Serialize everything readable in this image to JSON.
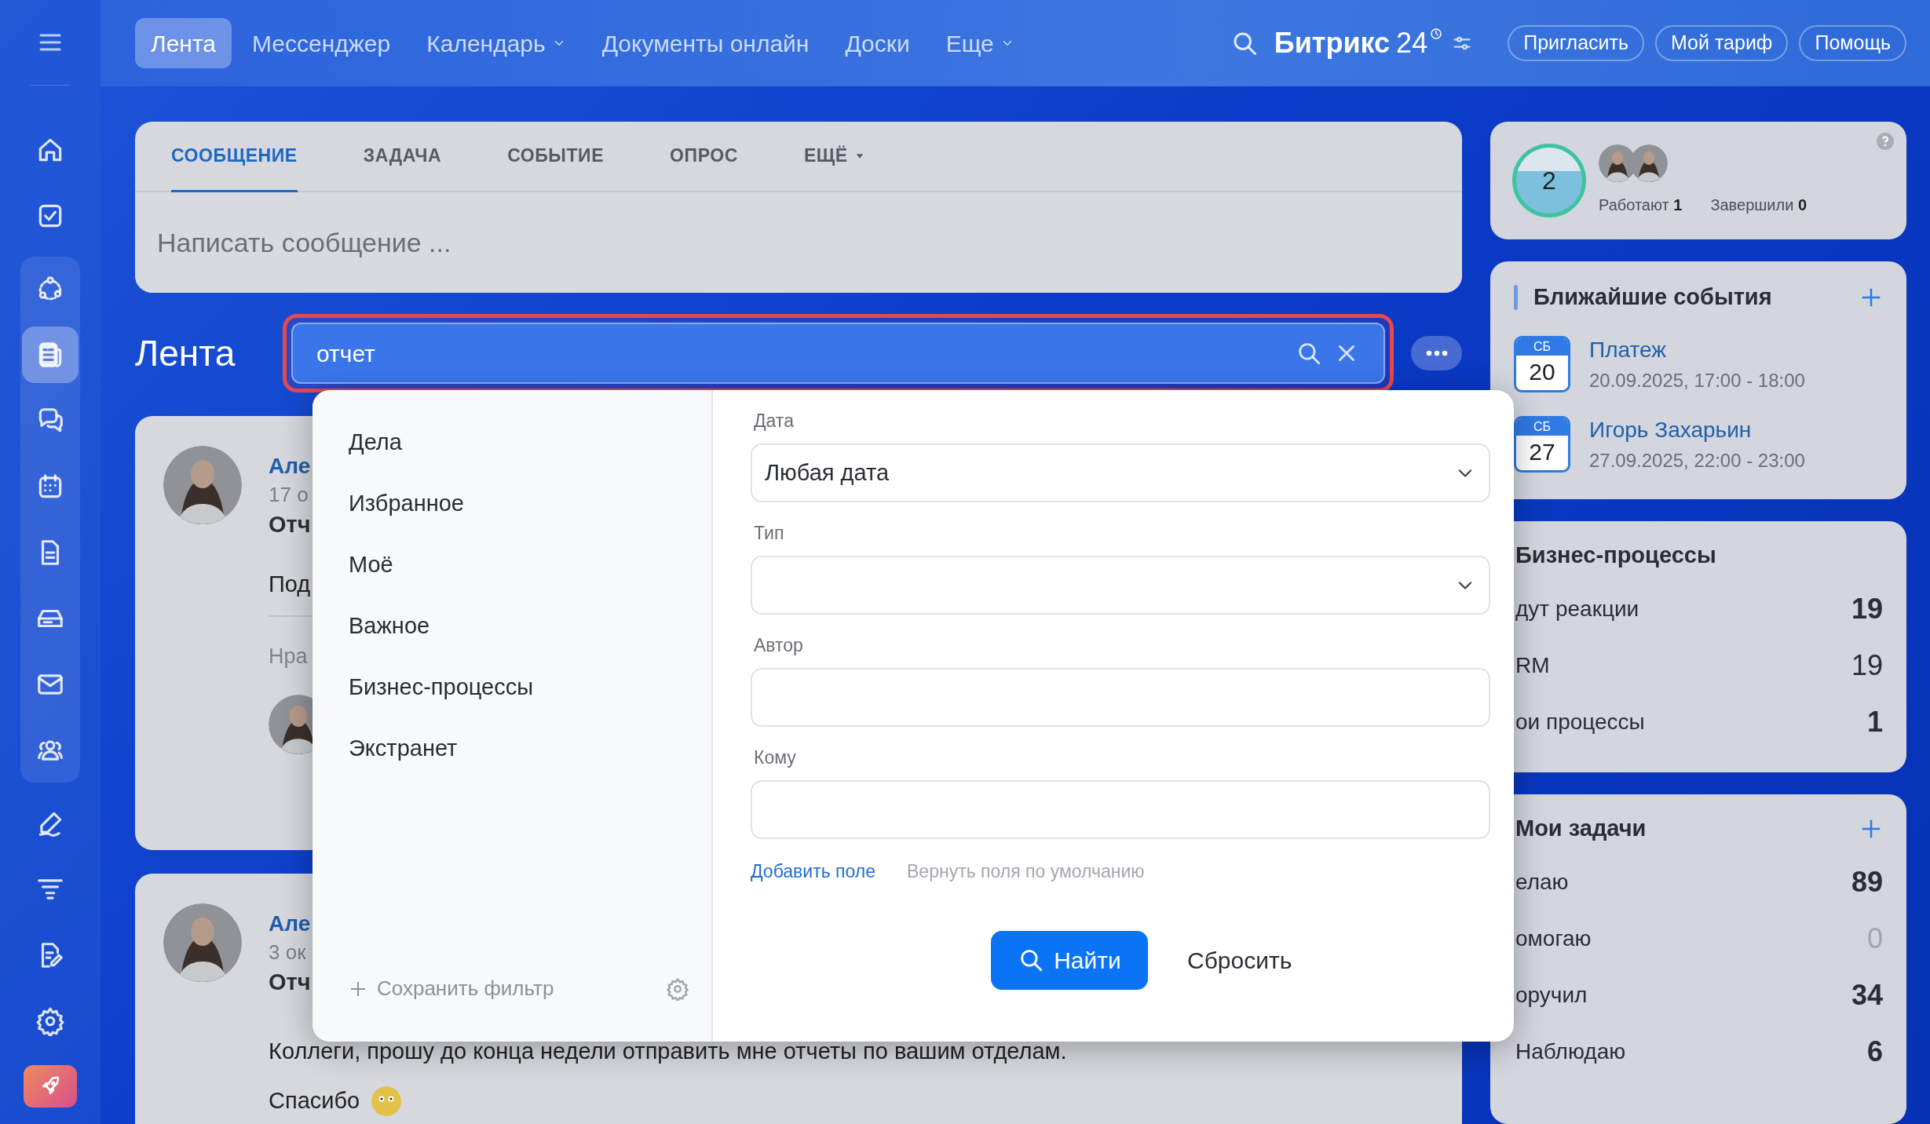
{
  "top_nav": {
    "items": [
      {
        "label": "Лента",
        "selected": true,
        "dropdown": false
      },
      {
        "label": "Мессенджер",
        "selected": false,
        "dropdown": false
      },
      {
        "label": "Календарь",
        "selected": false,
        "dropdown": true
      },
      {
        "label": "Документы онлайн",
        "selected": false,
        "dropdown": false
      },
      {
        "label": "Доски",
        "selected": false,
        "dropdown": false
      },
      {
        "label": "Еще",
        "selected": false,
        "dropdown": true
      }
    ],
    "brand": {
      "name": "Битрикс",
      "suffix": "24"
    },
    "buttons": [
      "Пригласить",
      "Мой тариф",
      "Помощь"
    ]
  },
  "sidebar": {
    "items": [
      {
        "kind": "home",
        "selected": false,
        "grouped": false
      },
      {
        "kind": "task",
        "selected": false,
        "grouped": false
      },
      {
        "kind": "nodes",
        "selected": false,
        "grouped": true
      },
      {
        "kind": "feed",
        "selected": true,
        "grouped": true
      },
      {
        "kind": "chat",
        "selected": false,
        "grouped": true
      },
      {
        "kind": "calendar",
        "selected": false,
        "grouped": true
      },
      {
        "kind": "document",
        "selected": false,
        "grouped": true
      },
      {
        "kind": "drive",
        "selected": false,
        "grouped": true
      },
      {
        "kind": "mail",
        "selected": false,
        "grouped": true
      },
      {
        "kind": "people",
        "selected": false,
        "grouped": true
      },
      {
        "kind": "pen",
        "selected": false,
        "grouped": false
      },
      {
        "kind": "funnel",
        "selected": false,
        "grouped": false
      },
      {
        "kind": "doc-edit",
        "selected": false,
        "grouped": false
      },
      {
        "kind": "gear",
        "selected": false,
        "grouped": false
      }
    ]
  },
  "composer": {
    "tabs": [
      {
        "label": "СООБЩЕНИЕ",
        "selected": true,
        "dropdown": false
      },
      {
        "label": "ЗАДАЧА",
        "selected": false,
        "dropdown": false
      },
      {
        "label": "СОБЫТИЕ",
        "selected": false,
        "dropdown": false
      },
      {
        "label": "ОПРОС",
        "selected": false,
        "dropdown": false
      },
      {
        "label": "ЕЩЁ",
        "selected": false,
        "dropdown": true
      }
    ],
    "placeholder": "Написать сообщение ..."
  },
  "feed": {
    "title": "Лента",
    "search": {
      "value": "отчет"
    },
    "posts": [
      {
        "author": "Але",
        "date": "17 о",
        "title": "Отч",
        "body": "Под",
        "reaction": "Нра"
      },
      {
        "author": "Але",
        "date": "3 ок",
        "title": "Отч",
        "body": "Коллеги, прошу до конца недели отправить мне отчеты по вашим отделам.",
        "thanks": "Спасибо"
      }
    ]
  },
  "filter": {
    "presets": [
      "Дела",
      "Избранное",
      "Моё",
      "Важное",
      "Бизнес-процессы",
      "Экстранет"
    ],
    "save_filter": "Сохранить фильтр",
    "fields": [
      {
        "label": "Дата",
        "kind": "select",
        "value": "Любая дата"
      },
      {
        "label": "Тип",
        "kind": "select"
      },
      {
        "label": "Автор",
        "kind": "text"
      },
      {
        "label": "Кому",
        "kind": "text"
      }
    ],
    "add_field": "Добавить поле",
    "restore_fields": "Вернуть поля по умолчанию",
    "find": "Найти",
    "reset": "Сбросить"
  },
  "right": {
    "workday": {
      "count": "2",
      "working_label": "Работают",
      "working": "1",
      "done_label": "Завершили",
      "done": "0"
    },
    "events": {
      "title": "Ближайшие события",
      "items": [
        {
          "day": "СБ",
          "date": "20",
          "title": "Платеж",
          "time": "20.09.2025, 17:00 - 18:00"
        },
        {
          "day": "СБ",
          "date": "27",
          "title": "Игорь Захарьин",
          "time": "27.09.2025, 22:00 - 23:00"
        }
      ]
    },
    "processes": {
      "title": "Бизнес-процессы",
      "rows": [
        {
          "label": "дут реакции",
          "count": "19",
          "bold": true,
          "muted": false
        },
        {
          "label": "RM",
          "count": "19",
          "bold": false,
          "muted": false
        },
        {
          "label": "ои процессы",
          "count": "1",
          "bold": true,
          "muted": false
        }
      ]
    },
    "tasks": {
      "title": "Мои задачи",
      "rows": [
        {
          "label": "елаю",
          "count": "89",
          "bold": true,
          "muted": false
        },
        {
          "label": "омогаю",
          "count": "0",
          "bold": false,
          "muted": true
        },
        {
          "label": "оручил",
          "count": "34",
          "bold": true,
          "muted": false
        },
        {
          "label": "Наблюдаю",
          "count": "6",
          "bold": true,
          "muted": false
        }
      ]
    }
  }
}
